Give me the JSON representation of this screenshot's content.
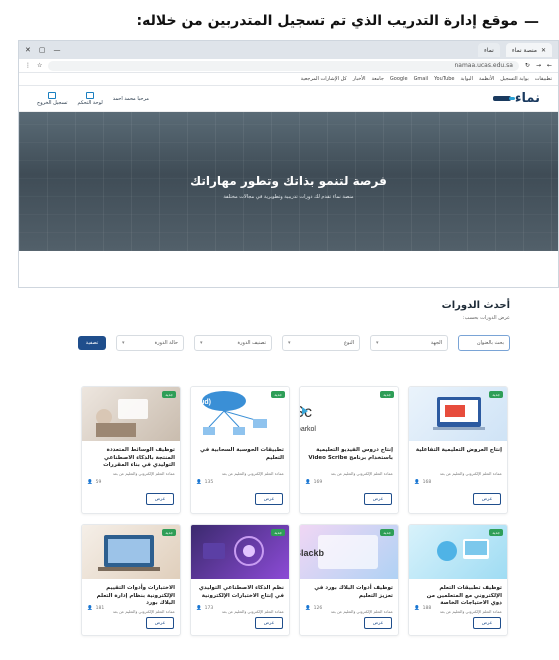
{
  "heading": "موقع إدارة التدريب الذي تم تسجيل المتدربين من خلاله:",
  "browser": {
    "tabs": [
      "منصة نماء",
      "نماء"
    ],
    "url": "namaa.ucas.edu.sa",
    "bookmarks": [
      "تطبيقات",
      "بوابة التسجيل",
      "الأنظمة",
      "البوابة",
      "YouTube",
      "Gmail",
      "Google",
      "جامعة",
      "الأخبار",
      "كل الإشارات المرجعية"
    ]
  },
  "site": {
    "brand": "نماء",
    "user_greeting": "مرحبا محمد احمد",
    "user_menu": [
      "لوحة التحكم",
      "تسجيل الخروج"
    ]
  },
  "hero": {
    "title": "فرصة لتنمو بذاتك وتطور مهاراتك",
    "subtitle": "منصة نماء تقدم لك دورات تدريبية وتطويرية في مجالات مختلفة"
  },
  "courses_section": {
    "title": "أحدث الدورات",
    "subtitle": "عرض الدورات بحسب:",
    "filters": {
      "search_placeholder": "بحث بالعنوان",
      "entity": "الجهة",
      "type": "النوع",
      "category": "تصنيف الدورة",
      "status": "حالة الدورة",
      "filter_button": "تصفية"
    }
  },
  "courses": [
    {
      "badge": "جديد",
      "title": "إنتاج العروض التعليمية التفاعلية",
      "desc": "عمادة التعلم الإلكتروني والتعليم عن بعد",
      "count": "168",
      "view": "عرض"
    },
    {
      "badge": "جديد",
      "title": "إنتاج دروس الفيديو التعليمية باستخدام برنامج Video Scribe",
      "desc": "عمادة التعلم الإلكتروني والتعليم عن بعد",
      "count": "169",
      "view": "عرض"
    },
    {
      "badge": "جديد",
      "title": "تطبيقات الحوسبة السحابية في التعليم",
      "desc": "عمادة التعلم الإلكتروني والتعليم عن بعد",
      "count": "135",
      "view": "عرض"
    },
    {
      "badge": "جديد",
      "title": "توظيف الوسائط المتعددة المنتجة بالذكاء الاصطناعي التوليدي في بناء المقررات الإلكترونية",
      "desc": "عمادة التعلم الإلكتروني والتعليم عن بعد",
      "count": "59",
      "view": "عرض"
    },
    {
      "badge": "جديد",
      "title": "توظيف تطبيقات التعلم الإلكتروني مع المتعلمين من ذوي الاحتياجات الخاصة",
      "desc": "عمادة التعلم الإلكتروني والتعليم عن بعد",
      "count": "188",
      "view": "عرض"
    },
    {
      "badge": "جديد",
      "title": "توظيف أدوات البلاك بورد في تعزيز التعليم",
      "desc": "عمادة التعلم الإلكتروني والتعليم عن بعد",
      "count": "126",
      "view": "عرض"
    },
    {
      "badge": "جديد",
      "title": "نظم الذكاء الاصطناعي التوليدي في إنتاج الاختبارات الإلكترونية",
      "desc": "عمادة التعلم الإلكتروني والتعليم عن بعد",
      "count": "173",
      "view": "عرض"
    },
    {
      "badge": "جديد",
      "title": "الاختبارات وأدوات التقييم الإلكترونية بنظام إدارة التعلم البلاك بورد",
      "desc": "عمادة التعلم الإلكتروني والتعليم عن بعد",
      "count": "181",
      "view": "عرض"
    }
  ],
  "colors": {
    "primary": "#1f4e8c",
    "badge": "#2e9e57",
    "brand": "#1a3a5f"
  }
}
